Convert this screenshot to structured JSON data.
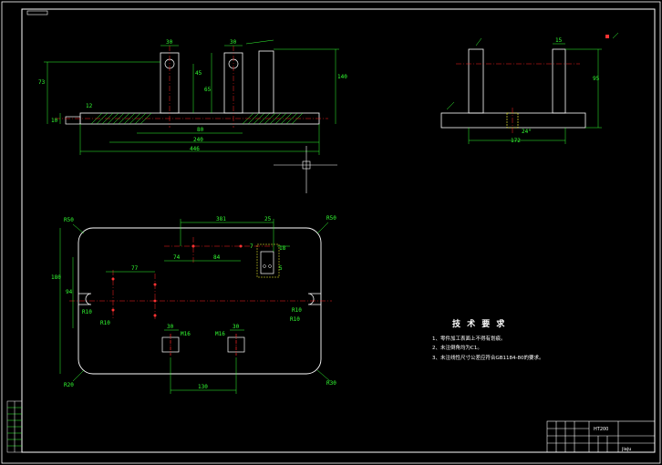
{
  "colors": {
    "background": "#000000",
    "outline": "#ffffff",
    "dimension": "#33ff33",
    "centerline": "#ff2222",
    "hidden": "#ffff33",
    "marker": "#ff3333"
  },
  "front_view": {
    "dims": {
      "top_left": "30",
      "top_right": "30",
      "height_overall": "73",
      "height_right": "140",
      "post_height_a": "45",
      "post_height_b": "65",
      "small_left": "12",
      "small_left_b": "10",
      "base_width_a": "80",
      "base_width_b": "240",
      "base_width_total": "446"
    }
  },
  "side_view": {
    "dims": {
      "top": "15",
      "height": "95",
      "width": "172",
      "slot_note": "24°"
    }
  },
  "plan_view": {
    "dims": {
      "top_span": "381",
      "top_small": "25",
      "right_small": "18",
      "mid_a": "74",
      "mid_b": "84",
      "left_a": "77",
      "vertical_a": "180",
      "vertical_b": "94",
      "hole_a": "30",
      "hole_b": "30",
      "bottom_span": "130",
      "small_note": "7",
      "small_note_b": "5"
    },
    "corner_radii": {
      "top_left": "R50",
      "top_right": "R50",
      "bottom_left": "R20",
      "bottom_right": "R30"
    },
    "slot_labels": {
      "left_a": "R10",
      "left_b": "R10",
      "right_a": "R10",
      "right_b": "R10"
    },
    "tapped_labels": {
      "left": "M16",
      "right": "M16"
    }
  },
  "notes": {
    "title": "技 术 要 求",
    "items": [
      "1、零件加工表面上不得有划痕。",
      "2、未注倒角均为C1。",
      "3、未注线性尺寸公差应符合GB1184-80的要求。"
    ]
  },
  "title_block": {
    "material": "HT200",
    "drawing_name": "jiaju"
  }
}
